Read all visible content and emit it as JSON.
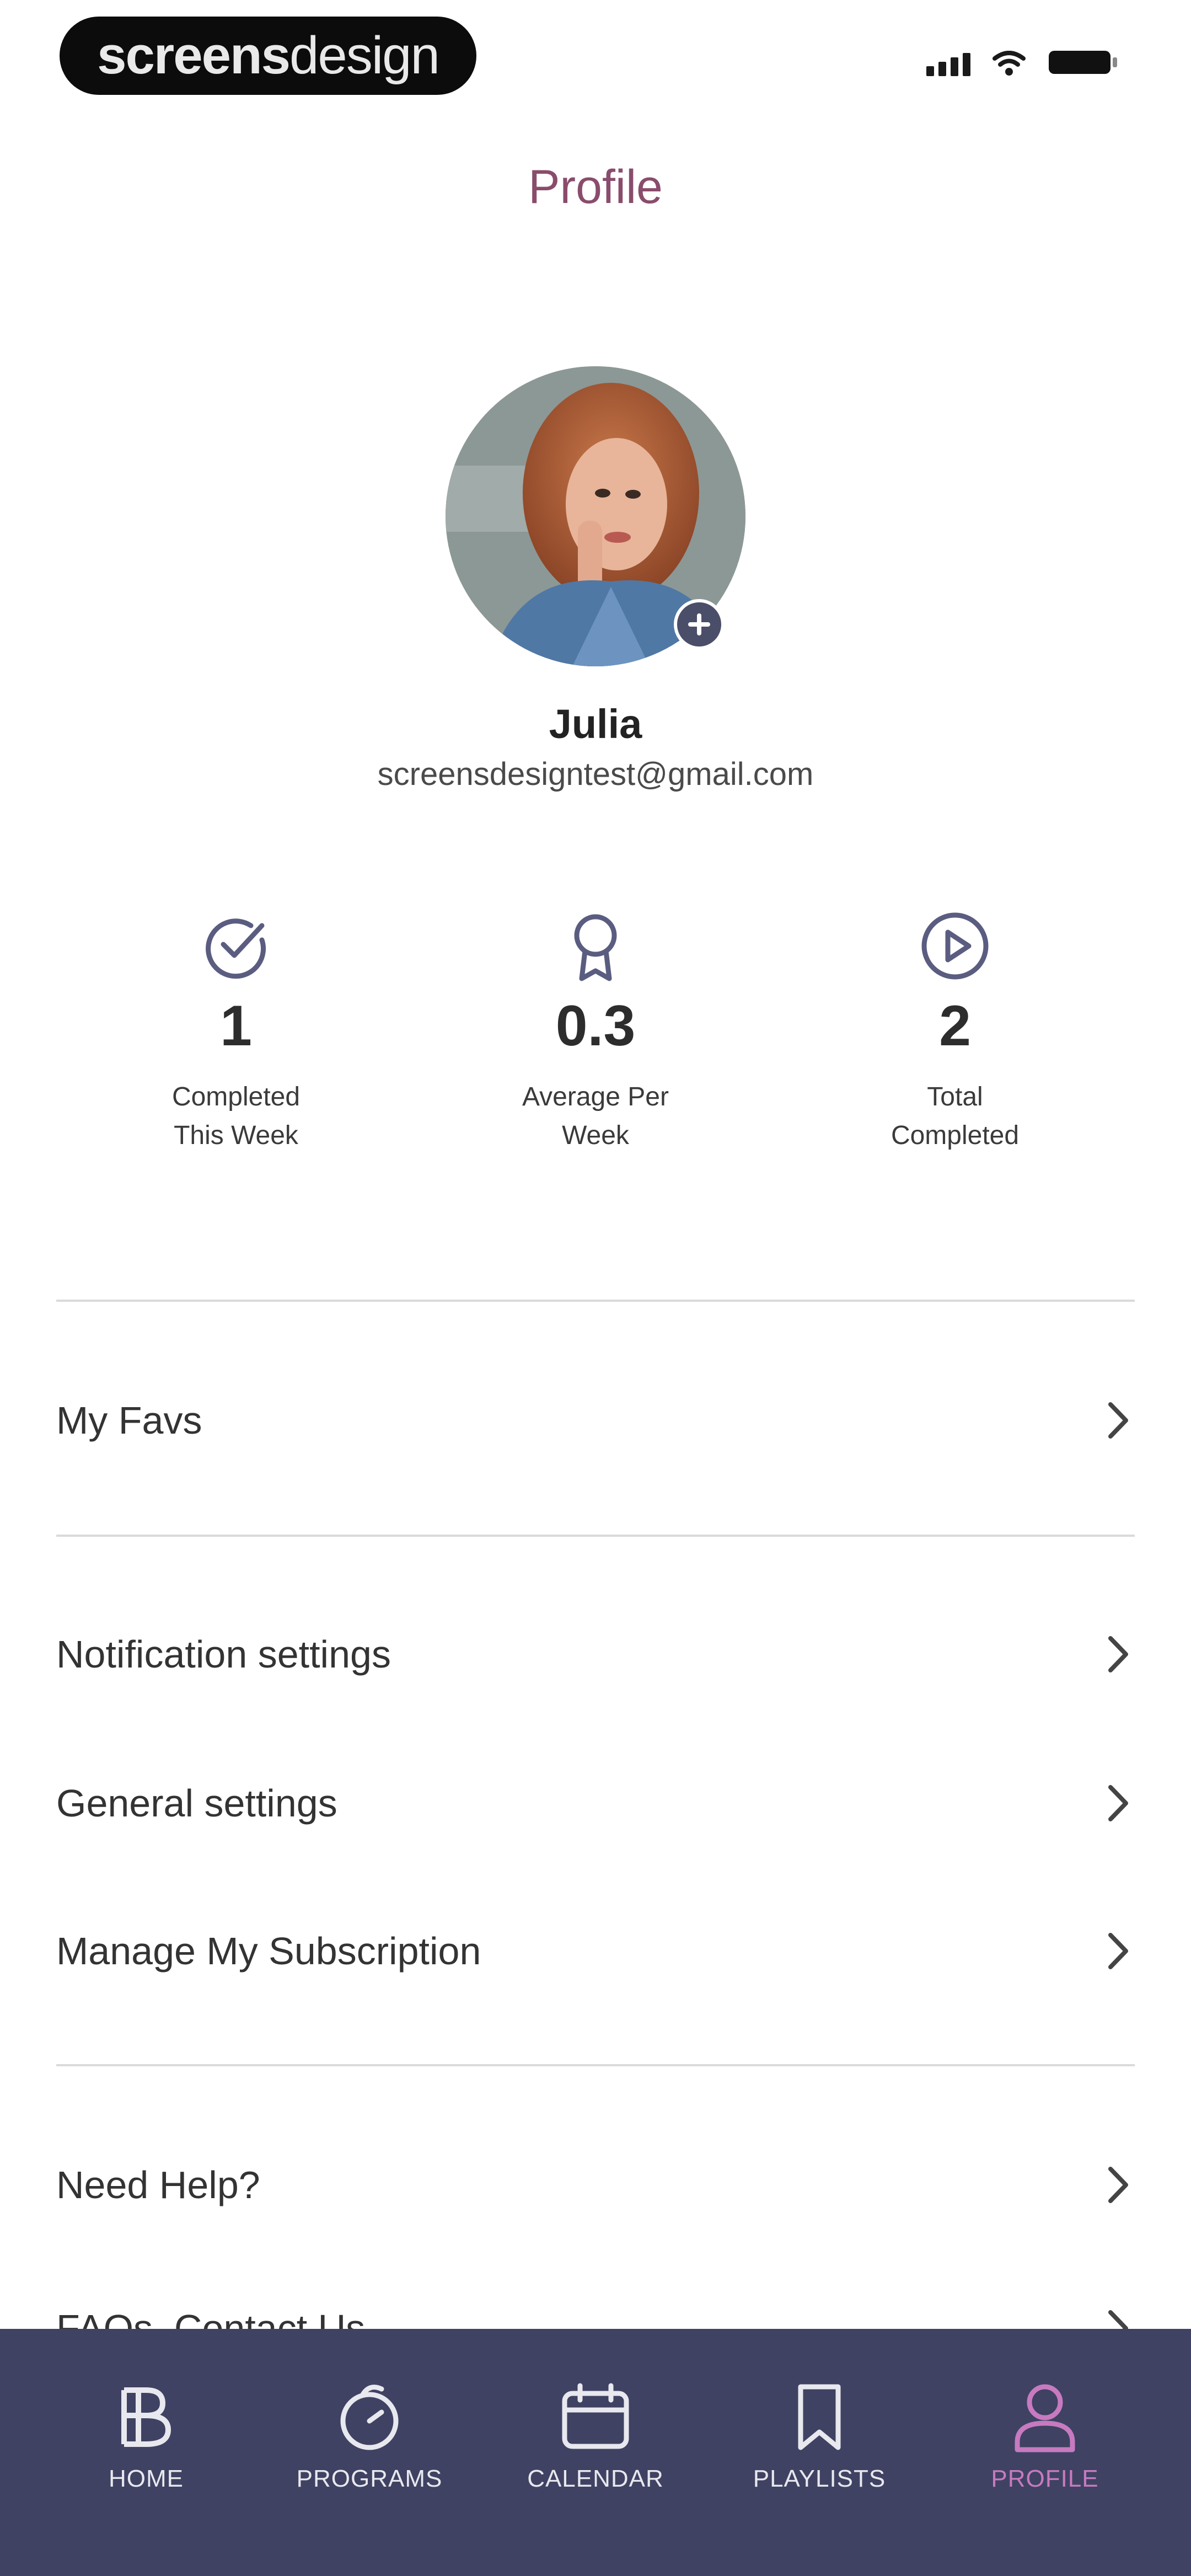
{
  "status_bar": {
    "brand_bold": "screens",
    "brand_light": "design"
  },
  "header": {
    "title": "Profile"
  },
  "profile": {
    "name": "Julia",
    "email": "screensdesigntest@gmail.com"
  },
  "stats": [
    {
      "icon": "check-circle-icon",
      "value": "1",
      "label": "Completed\nThis Week"
    },
    {
      "icon": "award-ribbon-icon",
      "value": "0.3",
      "label": "Average Per\nWeek"
    },
    {
      "icon": "play-circle-icon",
      "value": "2",
      "label": "Total\nCompleted"
    }
  ],
  "menu": {
    "favs": "My Favs",
    "notification_settings": "Notification settings",
    "general_settings": "General settings",
    "manage_subscription": "Manage My Subscription",
    "need_help": "Need Help?",
    "faq_contact": "FAQs, Contact Us"
  },
  "tabs": [
    {
      "icon": "home-logo-icon",
      "label": "HOME"
    },
    {
      "icon": "programs-icon",
      "label": "PROGRAMS"
    },
    {
      "icon": "calendar-icon",
      "label": "CALENDAR"
    },
    {
      "icon": "bookmark-icon",
      "label": "PLAYLISTS"
    },
    {
      "icon": "user-icon",
      "label": "PROFILE",
      "active": true
    }
  ],
  "colors": {
    "title": "#8a4c6c",
    "icon_stroke": "#5a5d80",
    "tab_bar_bg": "#3f4262",
    "tab_active": "#c77ac0"
  }
}
